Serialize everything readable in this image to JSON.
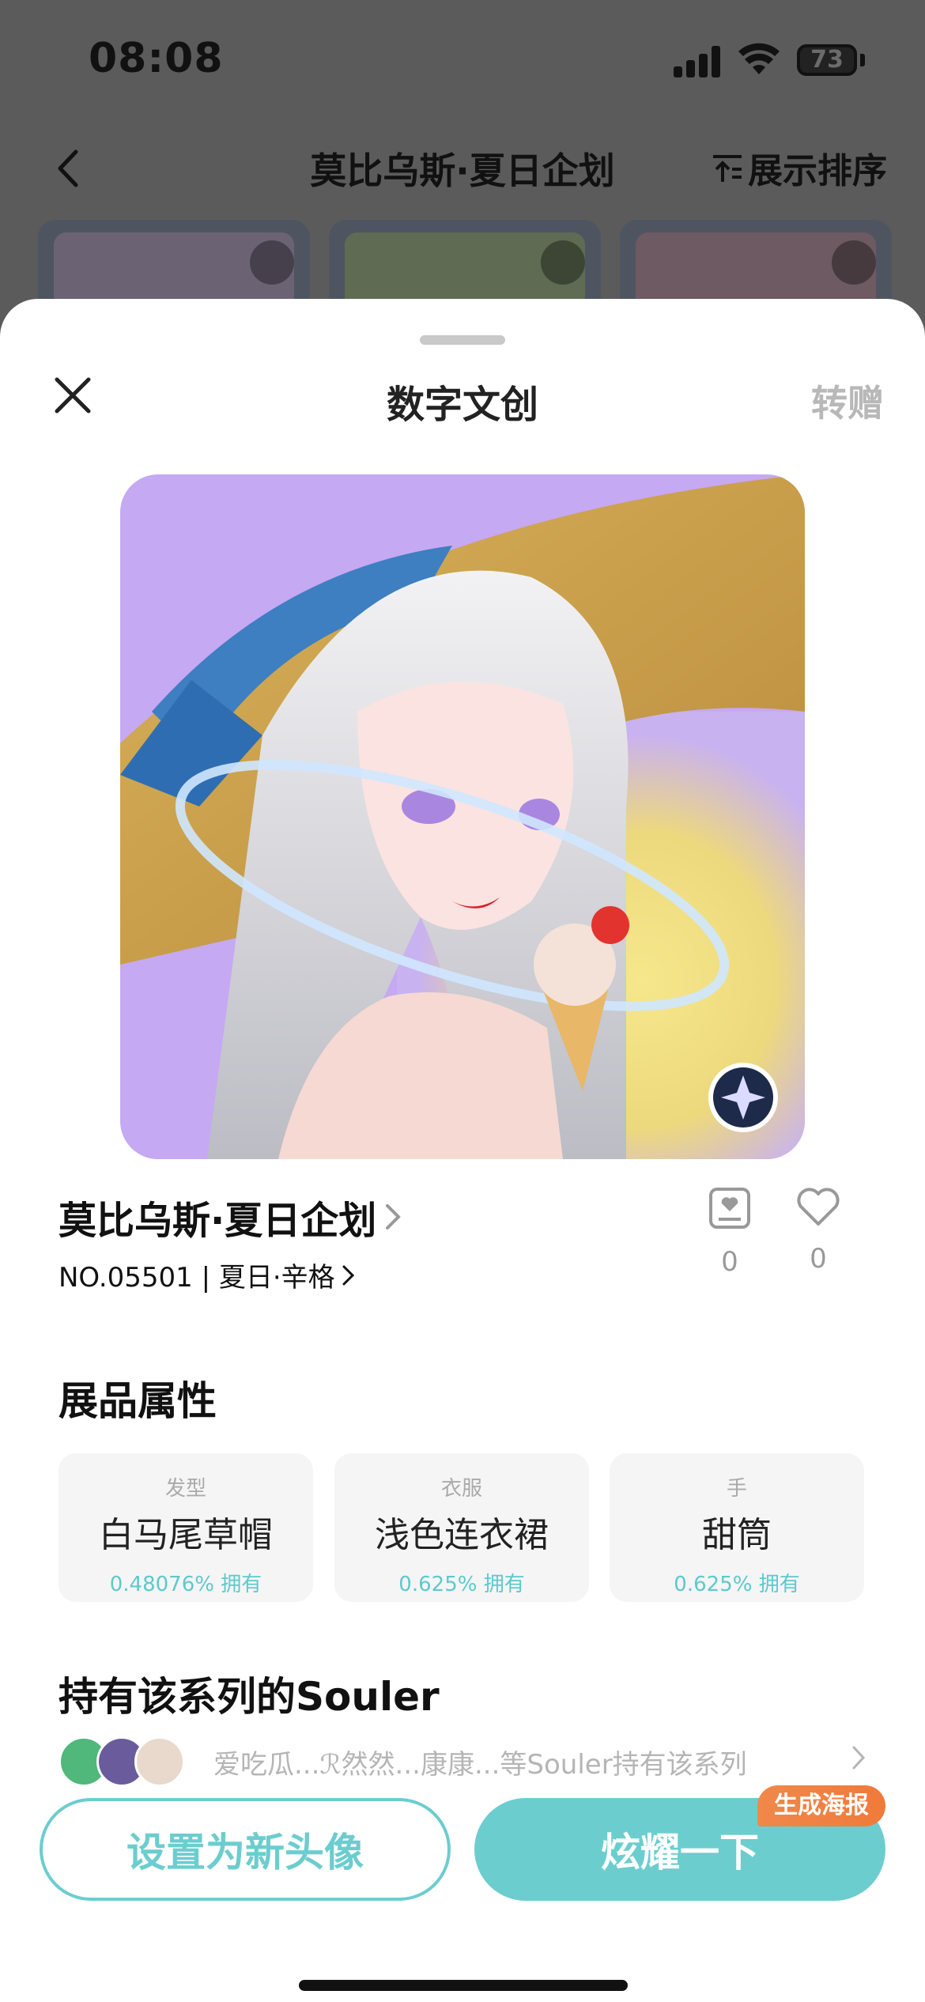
{
  "status_bar": {
    "time": "08:08",
    "battery": "73"
  },
  "nav": {
    "title": "莫比乌斯·夏日企划",
    "sort_label": "展示排序"
  },
  "sheet": {
    "title": "数字文创",
    "gift_label": "转赠"
  },
  "item": {
    "title": "莫比乌斯·夏日企划",
    "subtitle": "NO.05501 | 夏日·辛格",
    "collect_count": "0",
    "like_count": "0"
  },
  "attributes_section": {
    "title": "展品属性",
    "items": [
      {
        "category": "发型",
        "name": "白马尾草帽",
        "percent": "0.48076% 拥有"
      },
      {
        "category": "衣服",
        "name": "浅色连衣裙",
        "percent": "0.625% 拥有"
      },
      {
        "category": "手",
        "name": "甜筒",
        "percent": "0.625% 拥有"
      }
    ]
  },
  "owners_section": {
    "title": "持有该系列的Souler",
    "summary": "爱吃瓜...ℛ然然...康康...等Souler持有该系列"
  },
  "actions": {
    "set_avatar": "设置为新头像",
    "show_off": "炫耀一下",
    "poster_tag": "生成海报"
  },
  "colors": {
    "accent": "#6ccdcf",
    "tag": "#f07a3a"
  }
}
